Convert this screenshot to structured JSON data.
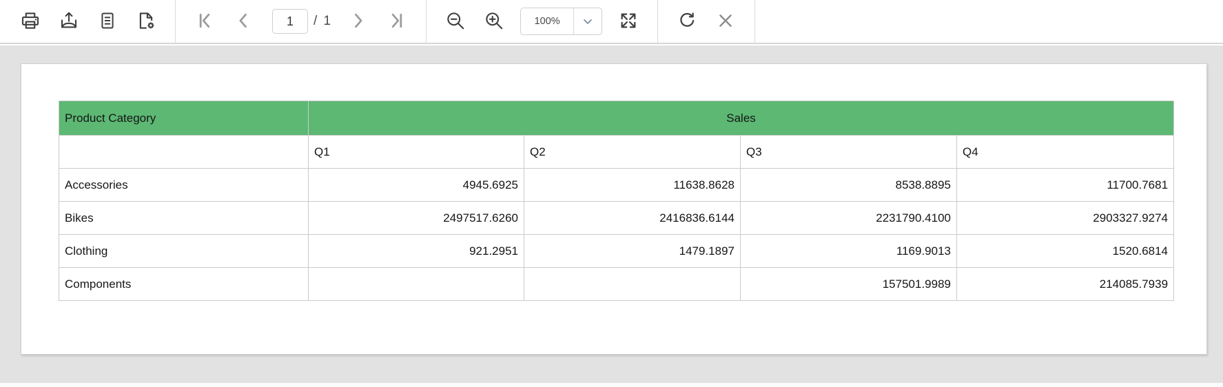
{
  "toolbar": {
    "print_label": "print",
    "export_label": "export",
    "print_layout_label": "print-layout",
    "page_setup_label": "page-setup",
    "page_number": "1",
    "page_total_label": "/ 1",
    "zoom_value": "100%",
    "icon_names": [
      "print",
      "export",
      "print-layout",
      "page-setup",
      "first-page",
      "previous-page",
      "next-page",
      "last-page",
      "zoom-out",
      "zoom-in",
      "zoom-dropdown",
      "fullscreen",
      "refresh",
      "close"
    ]
  },
  "colors": {
    "header_green": "#5cb873",
    "toolbar_icon_dark": "#3f3f3f",
    "toolbar_icon_gray": "#9b9b9b",
    "viewer_background": "#e2e2e2",
    "table_border": "#cbcbcb"
  },
  "report": {
    "table": {
      "header": {
        "category": "Product Category",
        "sales": "Sales"
      },
      "quarters": [
        "Q1",
        "Q2",
        "Q3",
        "Q4"
      ],
      "rows": [
        {
          "category": "Accessories",
          "values": [
            "4945.6925",
            "11638.8628",
            "8538.8895",
            "11700.7681"
          ]
        },
        {
          "category": "Bikes",
          "values": [
            "2497517.6260",
            "2416836.6144",
            "2231790.4100",
            "2903327.9274"
          ]
        },
        {
          "category": "Clothing",
          "values": [
            "921.2951",
            "1479.1897",
            "1169.9013",
            "1520.6814"
          ]
        },
        {
          "category": "Components",
          "values": [
            "",
            "",
            "157501.9989",
            "214085.7939"
          ]
        }
      ]
    }
  }
}
